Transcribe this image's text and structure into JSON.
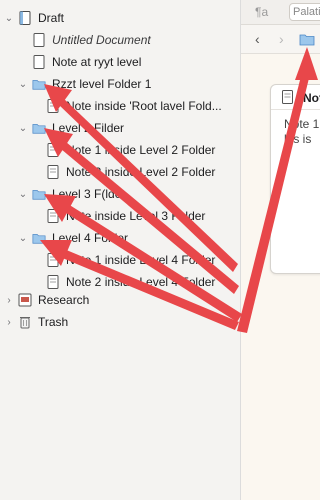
{
  "binder": {
    "draft": {
      "label": "Draft"
    },
    "items": [
      {
        "label": "Untitled Document",
        "italic": true
      },
      {
        "label": "Note at ryyt level"
      }
    ],
    "folder1": {
      "label": "Rzzt level Folder 1",
      "note": "Note inside 'Root lavel Fold..."
    },
    "folder2": {
      "label": "Level 2 Filder",
      "notes": [
        "Note 1 inside Level 2 Folder",
        "Note 2 inside Level 2 Folder"
      ]
    },
    "folder3": {
      "label": "Level 3 F(lder",
      "note": "Note inside Level 3 Folder"
    },
    "folder4": {
      "label": "Level 4 Folder",
      "notes": [
        "Note 1 inside Level 4 Folder",
        "Note 2 inside Level 4 Folder"
      ]
    },
    "research": {
      "label": "Research"
    },
    "trash": {
      "label": "Trash"
    }
  },
  "toolbar": {
    "paragraph_icon": "¶a",
    "font_value": "Palatin"
  },
  "editor": {
    "card_title": "Note",
    "card_line1": "Note 1",
    "card_line2": "his is"
  },
  "colors": {
    "arrow": "#e8474a",
    "folder": "#7fb3e0",
    "binder_bg": "#f4f3f1",
    "editor_bg": "#fbf7f0"
  }
}
